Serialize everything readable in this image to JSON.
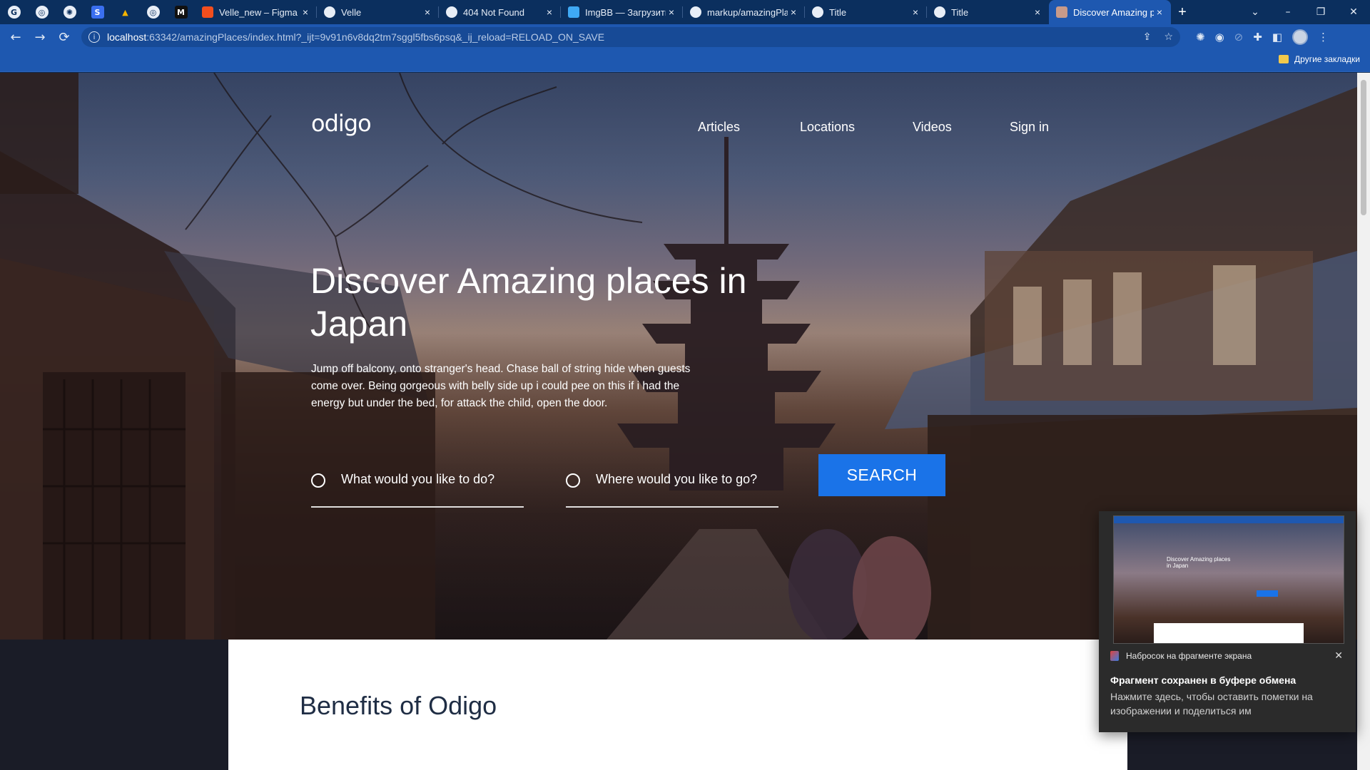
{
  "browser": {
    "pinned_tabs": [
      {
        "icon": "google-icon",
        "glyph": "G"
      },
      {
        "icon": "globe-icon",
        "glyph": "◎"
      },
      {
        "icon": "chatgpt-icon",
        "glyph": "✺"
      },
      {
        "icon": "skillbox-icon",
        "glyph": "S"
      },
      {
        "icon": "drive-icon",
        "glyph": "▲"
      },
      {
        "icon": "globe-icon",
        "glyph": "◎"
      },
      {
        "icon": "m-icon",
        "glyph": "M"
      }
    ],
    "tabs": [
      {
        "label": "Velle_new – Figma",
        "close": "×",
        "active": false
      },
      {
        "label": "Velle",
        "close": "×",
        "active": false
      },
      {
        "label": "404 Not Found",
        "close": "×",
        "active": false
      },
      {
        "label": "ImgBB — Загрузить",
        "close": "×",
        "active": false
      },
      {
        "label": "markup/amazingPla",
        "close": "×",
        "active": false
      },
      {
        "label": "Title",
        "close": "×",
        "active": false
      },
      {
        "label": "Title",
        "close": "×",
        "active": false
      },
      {
        "label": "Discover Amazing p",
        "close": "×",
        "active": true
      }
    ],
    "new_tab_glyph": "+",
    "window_controls": {
      "menu": "⌄",
      "minimize": "–",
      "restore": "❐",
      "close": "✕"
    },
    "nav": {
      "back": "←",
      "forward": "→",
      "reload": "⟳"
    },
    "url_host": "localhost",
    "url_rest": ":63342/amazingPlaces/index.html?_ijt=9v91n6v8dq2tm7sggl5fbs6psq&_ij_reload=RELOAD_ON_SAVE",
    "omnibox_icons": {
      "share": "⇪",
      "star": "☆"
    },
    "bookmarks_other": "Другие закладки"
  },
  "page": {
    "logo": "odigo",
    "nav": [
      "Articles",
      "Locations",
      "Videos",
      "Sign in"
    ],
    "hero_title": "Discover Amazing places in Japan",
    "hero_text": "Jump off balcony, onto stranger's head. Chase ball of string hide when guests come over. Being gorgeous with belly side up i could pee on this if i had the energy but under the bed, for attack the child, open the door.",
    "search": {
      "what_placeholder": "What would you like to do?",
      "where_placeholder": "Where would you like to go?",
      "button": "SEARCH"
    },
    "benefits_title": "Benefits of Odigo"
  },
  "notification": {
    "app": "Набросок на фрагменте экрана",
    "close": "✕",
    "title": "Фрагмент сохранен в буфере обмена",
    "body": "Нажмите здесь, чтобы оставить пометки на изображении и поделиться им",
    "thumb_title": "Discover Amazing places in Japan"
  },
  "colors": {
    "tabbar": "#0b2f5e",
    "toolbar": "#1e58b0",
    "search_button": "#1a73e8",
    "benefits_title": "#1f2d44"
  }
}
